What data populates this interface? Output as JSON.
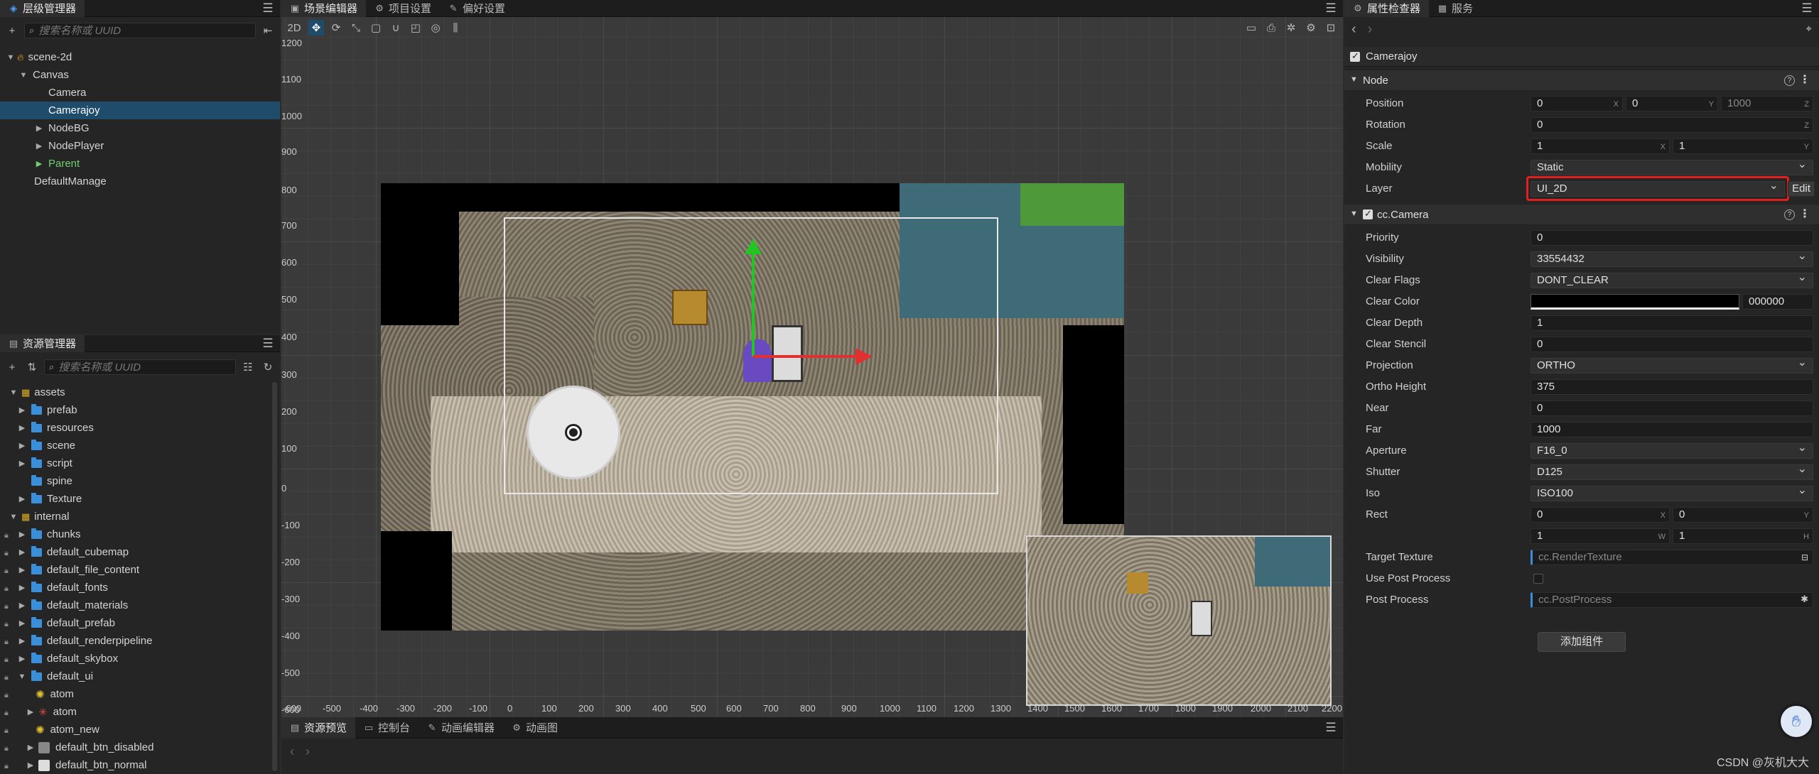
{
  "colors": {
    "accent": "#1f4c6b",
    "highlight_box": "#e02020",
    "green_axis": "#22c522",
    "red_axis": "#e03030"
  },
  "hierarchy": {
    "tab": "层级管理器",
    "search_placeholder": "搜索名称或 UUID",
    "nodes": [
      {
        "label": "scene-2d"
      },
      {
        "label": "Canvas"
      },
      {
        "label": "Camera"
      },
      {
        "label": "Camerajoy"
      },
      {
        "label": "NodeBG"
      },
      {
        "label": "NodePlayer"
      },
      {
        "label": "Parent"
      },
      {
        "label": "DefaultManage"
      }
    ]
  },
  "assets": {
    "tab": "资源管理器",
    "search_placeholder": "搜索名称或 UUID",
    "items": [
      {
        "label": "assets"
      },
      {
        "label": "prefab"
      },
      {
        "label": "resources"
      },
      {
        "label": "scene"
      },
      {
        "label": "script"
      },
      {
        "label": "spine"
      },
      {
        "label": "Texture"
      },
      {
        "label": "internal"
      },
      {
        "label": "chunks"
      },
      {
        "label": "default_cubemap"
      },
      {
        "label": "default_file_content"
      },
      {
        "label": "default_fonts"
      },
      {
        "label": "default_materials"
      },
      {
        "label": "default_prefab"
      },
      {
        "label": "default_renderpipeline"
      },
      {
        "label": "default_skybox"
      },
      {
        "label": "default_ui"
      },
      {
        "label": "atom"
      },
      {
        "label": "atom"
      },
      {
        "label": "atom_new"
      },
      {
        "label": "default_btn_disabled"
      },
      {
        "label": "default_btn_normal"
      }
    ]
  },
  "scene_tabs": [
    "场景编辑器",
    "项目设置",
    "偏好设置"
  ],
  "scene": {
    "mode_2d": "2D",
    "y_ticks": [
      "1200",
      "1100",
      "1000",
      "900",
      "800",
      "700",
      "600",
      "500",
      "400",
      "300",
      "200",
      "100",
      "0",
      "-100",
      "-200",
      "-300",
      "-400",
      "-500",
      "-600"
    ],
    "x_ticks": [
      "-600",
      "-500",
      "-400",
      "-300",
      "-200",
      "-100",
      "0",
      "100",
      "200",
      "300",
      "400",
      "500",
      "600",
      "700",
      "800",
      "900",
      "1000",
      "1100",
      "1200",
      "1300",
      "1400",
      "1500",
      "1600",
      "1700",
      "1800",
      "1900",
      "2000",
      "2100",
      "2200"
    ]
  },
  "bottom_tabs": [
    "资源预览",
    "控制台",
    "动画编辑器",
    "动画图"
  ],
  "inspector": {
    "tabs": [
      "属性检查器",
      "服务"
    ],
    "node_name": "Camerajoy",
    "node_section": "Node",
    "position": {
      "label": "Position",
      "x": "0",
      "y": "0",
      "z": "1000",
      "sx": "X",
      "sy": "Y",
      "sz": "Z"
    },
    "rotation": {
      "label": "Rotation",
      "z": "0",
      "sz": "Z"
    },
    "scale": {
      "label": "Scale",
      "x": "1",
      "y": "1",
      "sx": "X",
      "sy": "Y"
    },
    "mobility": {
      "label": "Mobility",
      "value": "Static"
    },
    "layer": {
      "label": "Layer",
      "value": "UI_2D",
      "edit": "Edit"
    },
    "camera_section": "cc.Camera",
    "priority": {
      "label": "Priority",
      "value": "0"
    },
    "visibility": {
      "label": "Visibility",
      "value": "33554432"
    },
    "clear_flags": {
      "label": "Clear Flags",
      "value": "DONT_CLEAR"
    },
    "clear_color": {
      "label": "Clear Color",
      "hex": "000000"
    },
    "clear_depth": {
      "label": "Clear Depth",
      "value": "1"
    },
    "clear_stencil": {
      "label": "Clear Stencil",
      "value": "0"
    },
    "projection": {
      "label": "Projection",
      "value": "ORTHO"
    },
    "ortho_height": {
      "label": "Ortho Height",
      "value": "375"
    },
    "near": {
      "label": "Near",
      "value": "0"
    },
    "far": {
      "label": "Far",
      "value": "1000"
    },
    "aperture": {
      "label": "Aperture",
      "value": "F16_0"
    },
    "shutter": {
      "label": "Shutter",
      "value": "D125"
    },
    "iso": {
      "label": "Iso",
      "value": "ISO100"
    },
    "rect": {
      "label": "Rect",
      "x": "0",
      "y": "0",
      "w": "1",
      "h": "1",
      "sx": "X",
      "sy": "Y",
      "sw": "W",
      "sh": "H"
    },
    "target_texture": {
      "label": "Target Texture",
      "value": "cc.RenderTexture"
    },
    "use_post_process": {
      "label": "Use Post Process"
    },
    "post_process": {
      "label": "Post Process",
      "value": "cc.PostProcess"
    },
    "add_component": "添加组件"
  },
  "watermark": "CSDN @灰机大大"
}
